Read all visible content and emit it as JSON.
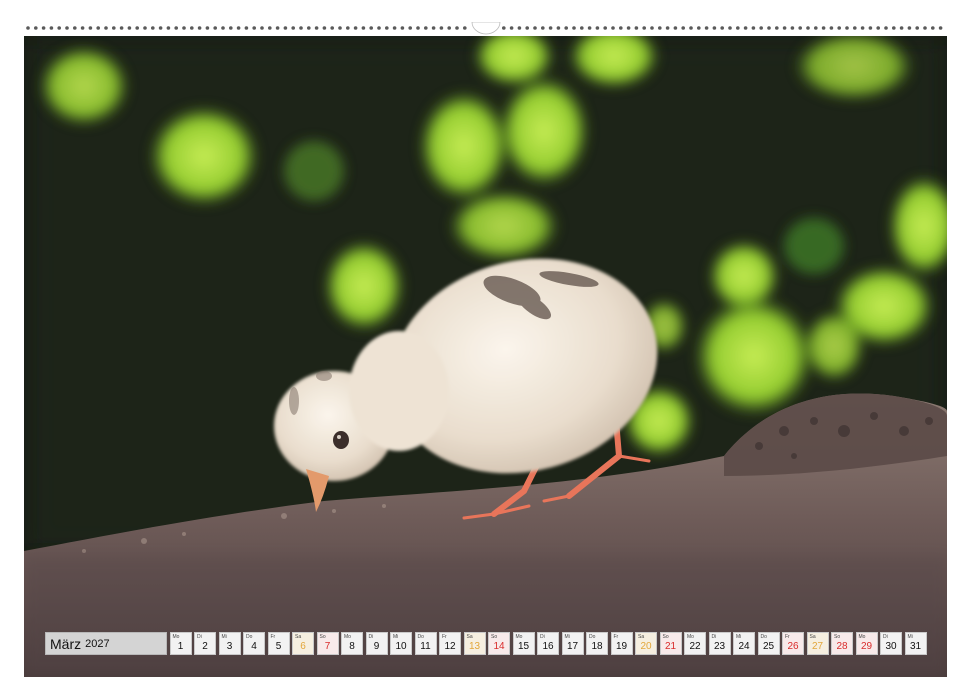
{
  "calendar": {
    "month": "März",
    "year": "2027",
    "days": [
      {
        "wd": "Mo",
        "num": "1",
        "type": "weekday"
      },
      {
        "wd": "Di",
        "num": "2",
        "type": "weekday"
      },
      {
        "wd": "Mi",
        "num": "3",
        "type": "weekday"
      },
      {
        "wd": "Do",
        "num": "4",
        "type": "weekday"
      },
      {
        "wd": "Fr",
        "num": "5",
        "type": "weekday"
      },
      {
        "wd": "Sa",
        "num": "6",
        "type": "sat"
      },
      {
        "wd": "So",
        "num": "7",
        "type": "sun"
      },
      {
        "wd": "Mo",
        "num": "8",
        "type": "weekday"
      },
      {
        "wd": "Di",
        "num": "9",
        "type": "weekday"
      },
      {
        "wd": "Mi",
        "num": "10",
        "type": "weekday"
      },
      {
        "wd": "Do",
        "num": "11",
        "type": "weekday"
      },
      {
        "wd": "Fr",
        "num": "12",
        "type": "weekday"
      },
      {
        "wd": "Sa",
        "num": "13",
        "type": "sat"
      },
      {
        "wd": "So",
        "num": "14",
        "type": "sun"
      },
      {
        "wd": "Mo",
        "num": "15",
        "type": "weekday"
      },
      {
        "wd": "Di",
        "num": "16",
        "type": "weekday"
      },
      {
        "wd": "Mi",
        "num": "17",
        "type": "weekday"
      },
      {
        "wd": "Do",
        "num": "18",
        "type": "weekday"
      },
      {
        "wd": "Fr",
        "num": "19",
        "type": "weekday"
      },
      {
        "wd": "Sa",
        "num": "20",
        "type": "sat"
      },
      {
        "wd": "So",
        "num": "21",
        "type": "sun"
      },
      {
        "wd": "Mo",
        "num": "22",
        "type": "weekday"
      },
      {
        "wd": "Di",
        "num": "23",
        "type": "weekday"
      },
      {
        "wd": "Mi",
        "num": "24",
        "type": "weekday"
      },
      {
        "wd": "Do",
        "num": "25",
        "type": "weekday"
      },
      {
        "wd": "Fr",
        "num": "26",
        "type": "sun"
      },
      {
        "wd": "Sa",
        "num": "27",
        "type": "sat"
      },
      {
        "wd": "So",
        "num": "28",
        "type": "sun"
      },
      {
        "wd": "Mo",
        "num": "29",
        "type": "sun"
      },
      {
        "wd": "Di",
        "num": "30",
        "type": "weekday"
      },
      {
        "wd": "Mi",
        "num": "31",
        "type": "weekday"
      }
    ]
  },
  "colors": {
    "background_green": "#9fd13a",
    "background_dark": "#1a1f17",
    "rock": "#6f5a55",
    "chick": "#efe6da",
    "saturday": "#e3a73a",
    "sunday": "#d92b2b"
  }
}
